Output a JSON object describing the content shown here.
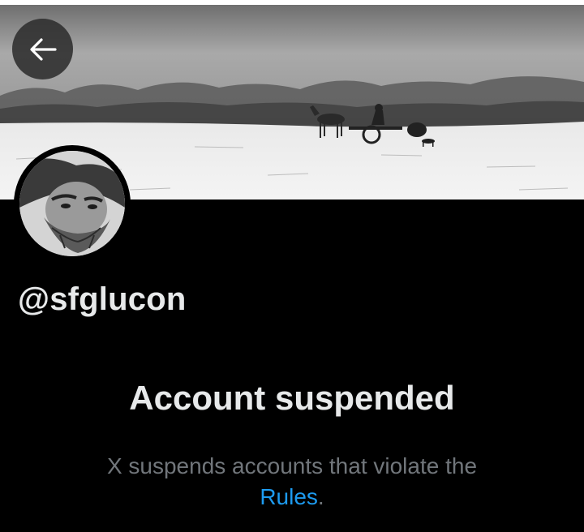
{
  "header": {
    "back_icon": "arrow-left-icon"
  },
  "banner": {
    "description_icon": "banner-image"
  },
  "profile": {
    "avatar_icon": "avatar-image",
    "handle": "@sfglucon"
  },
  "notice": {
    "title": "Account suspended",
    "description_prefix": "X suspends accounts that violate the",
    "link_label": "Rules",
    "description_suffix": "."
  },
  "colors": {
    "background": "#000000",
    "primary_text": "#e7e9ea",
    "secondary_text": "#71767b",
    "link": "#1d9bf0"
  }
}
